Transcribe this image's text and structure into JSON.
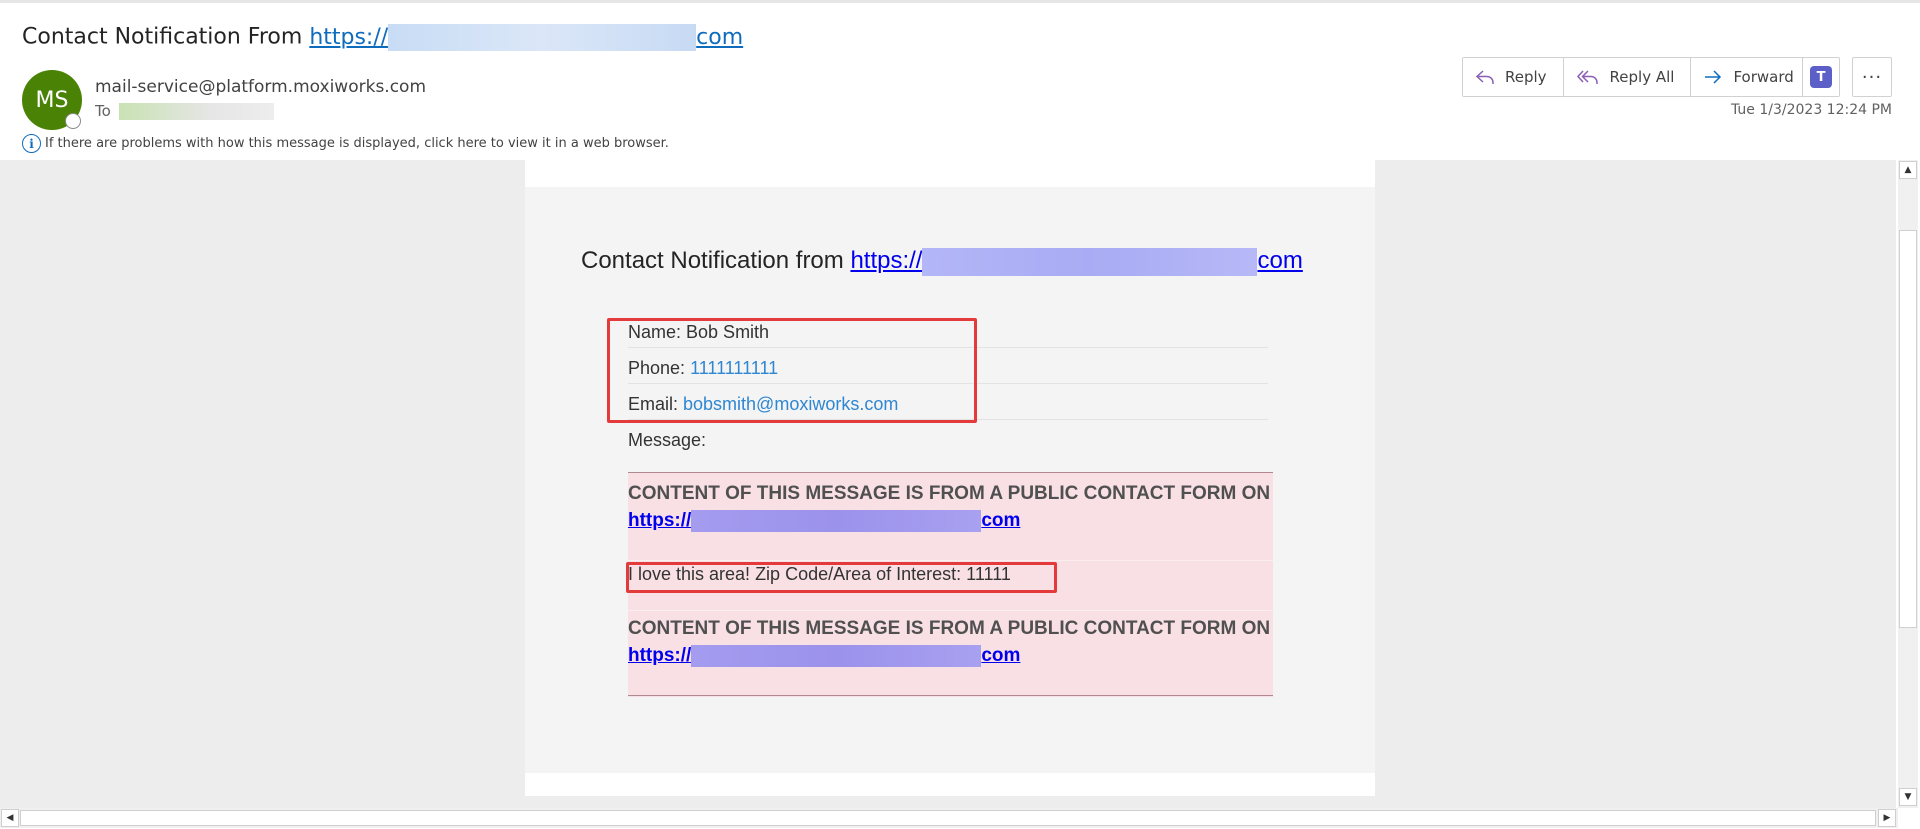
{
  "header": {
    "subject_prefix": "Contact Notification From ",
    "subject_link_start": "https://",
    "subject_link_end": "com",
    "avatar_initials": "MS",
    "sender": "mail-service@platform.moxiworks.com",
    "to_label": "To",
    "info_text": "If there are problems with how this message is displayed, click here to view it in a web browser.",
    "date": "Tue 1/3/2023 12:24 PM"
  },
  "toolbar": {
    "reply_label": "Reply",
    "reply_all_label": "Reply All",
    "forward_label": "Forward",
    "teams_label": "T",
    "more_label": "···"
  },
  "message": {
    "heading_prefix": "Contact Notification from ",
    "heading_link_start": "https://",
    "heading_link_end": "com",
    "name_label": "Name: ",
    "name_value": "Bob Smith",
    "phone_label": "Phone: ",
    "phone_value": "1111111111",
    "email_label": "Email: ",
    "email_value": "bobsmith@moxiworks.com",
    "message_label": "Message:",
    "notice_text": "CONTENT OF THIS MESSAGE IS FROM A PUBLIC CONTACT FORM ON ",
    "notice_link_start": "https://",
    "notice_link_end": "com",
    "message_text": "I love this area! Zip Code/Area of Interest: 11111"
  },
  "colors": {
    "avatar": "#498205",
    "link": "#0f6cbd",
    "highlight_box": "#e33b3b",
    "message_background": "#f8e0e5"
  },
  "icons": [
    "reply-icon",
    "reply-all-icon",
    "forward-icon",
    "teams-icon",
    "more-icon",
    "info-icon"
  ]
}
